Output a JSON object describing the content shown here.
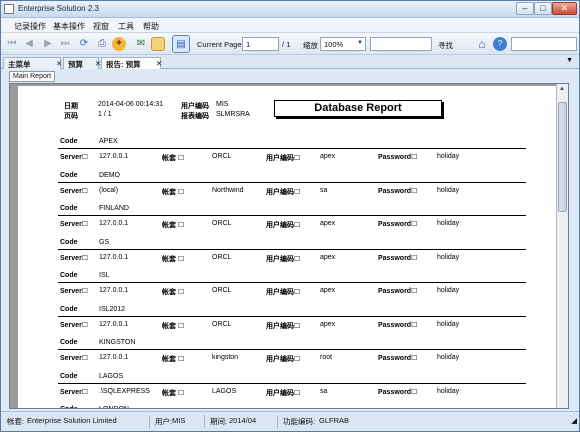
{
  "window": {
    "title": "Enterprise Solution  2.3"
  },
  "menu": [
    "记录操作",
    "基本操作",
    "视窗",
    "工具",
    "帮助"
  ],
  "toolbar": {
    "current_page_label": "Current Page",
    "current_page_value": "1",
    "total_pages": "/ 1",
    "zoom_label": "缩放",
    "zoom_value": "100%",
    "search_value": "",
    "find_label": "寻找"
  },
  "tabs": [
    {
      "label": "主菜单",
      "active": false
    },
    {
      "label": "预算",
      "active": false
    },
    {
      "label": "报告: 预算",
      "active": true
    }
  ],
  "subtab": "Main Report",
  "report": {
    "title": "Database Report",
    "date_label": "日期",
    "date_value": "2014-04-06 00:14:31",
    "page_label": "页码",
    "page_value": "1 / 1",
    "user_label": "用户编码",
    "user_value": "MIS",
    "form_label": "报表编码",
    "form_value": "SLMRSRA",
    "labels": {
      "code": "Code",
      "server": "Server",
      "account": "帐套",
      "user_code": "用户编码",
      "password": "Password"
    },
    "records": [
      {
        "code": "APEX",
        "server": "127.0.0.1",
        "account": "ORCL",
        "user": "apex",
        "password": "holiday"
      },
      {
        "code": "DEMO",
        "server": "(local)",
        "account": "Northwind",
        "user": "sa",
        "password": "holiday"
      },
      {
        "code": "FINLAND",
        "server": "127.0.0.1",
        "account": "ORCL",
        "user": "apex",
        "password": "holiday"
      },
      {
        "code": "GS",
        "server": "127.0.0.1",
        "account": "ORCL",
        "user": "apex",
        "password": "holiday"
      },
      {
        "code": "ISL",
        "server": "127.0.0.1",
        "account": "ORCL",
        "user": "apex",
        "password": "holiday"
      },
      {
        "code": "ISL2012",
        "server": "127.0.0.1",
        "account": "ORCL",
        "user": "apex",
        "password": "holiday"
      },
      {
        "code": "KINGSTON",
        "server": "127.0.0.1",
        "account": "kingston",
        "user": "root",
        "password": "holiday"
      },
      {
        "code": "LAGOS",
        "server": ".\\SQLEXPRESS",
        "account": "LAGOS",
        "user": "sa",
        "password": "holiday"
      },
      {
        "code": "LONDON",
        "server": "",
        "account": "",
        "user": "",
        "password": ""
      }
    ]
  },
  "status": {
    "company_label": "帐套:",
    "company_value": "Enterprise Solution Limited",
    "user_label": "用户:",
    "user_value": "MIS",
    "period_label": "期间:",
    "period_value": "2014/04",
    "func_label": "功能编码:",
    "func_value": "GLFRAB"
  }
}
